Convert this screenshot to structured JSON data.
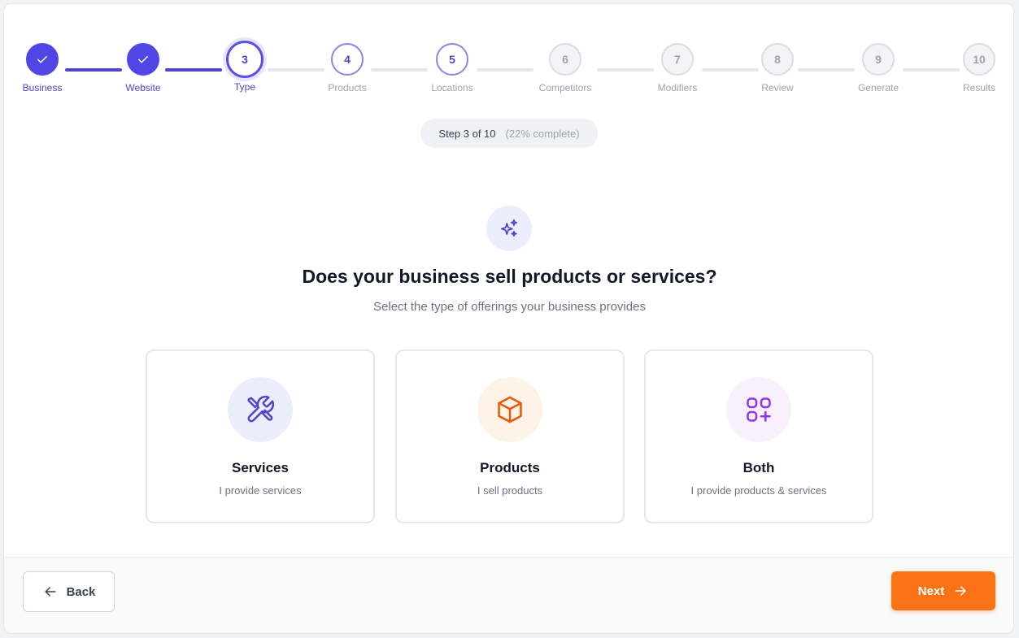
{
  "stepper": {
    "steps": [
      {
        "number": "1",
        "label": "Business",
        "status": "completed"
      },
      {
        "number": "2",
        "label": "Website",
        "status": "completed"
      },
      {
        "number": "3",
        "label": "Type",
        "status": "current"
      },
      {
        "number": "4",
        "label": "Products",
        "status": "upcoming"
      },
      {
        "number": "5",
        "label": "Locations",
        "status": "upcoming"
      },
      {
        "number": "6",
        "label": "Competitors",
        "status": "upcoming"
      },
      {
        "number": "7",
        "label": "Modifiers",
        "status": "upcoming"
      },
      {
        "number": "8",
        "label": "Review",
        "status": "upcoming"
      },
      {
        "number": "9",
        "label": "Generate",
        "status": "upcoming"
      },
      {
        "number": "10",
        "label": "Results",
        "status": "upcoming"
      }
    ],
    "check_icon": "check-icon"
  },
  "progress": {
    "step_text": "Step 3 of 10",
    "percent_text": "(22% complete)",
    "percent_value": 22
  },
  "header": {
    "icon": "sparkles-icon",
    "question": "Does your business sell products or services?",
    "subtitle": "Select the type of offerings your business provides"
  },
  "options": [
    {
      "id": "services",
      "title": "Services",
      "description": "I provide services",
      "icon": "wrench-screwdriver-icon",
      "icon_color": "#4f46c8",
      "icon_bg": "#eceefe"
    },
    {
      "id": "products",
      "title": "Products",
      "description": "I sell products",
      "icon": "box-icon",
      "icon_color": "#ea580c",
      "icon_bg": "#fdf3e7"
    },
    {
      "id": "both",
      "title": "Both",
      "description": "I provide products & services",
      "icon": "grid-plus-icon",
      "icon_color": "#9333ea",
      "icon_bg": "#f8f0fd"
    }
  ],
  "footer": {
    "back_label": "Back",
    "next_label": "Next",
    "next_color": "#f97316"
  },
  "colors": {
    "accent": "#4f46e5",
    "cta": "#f97316"
  }
}
